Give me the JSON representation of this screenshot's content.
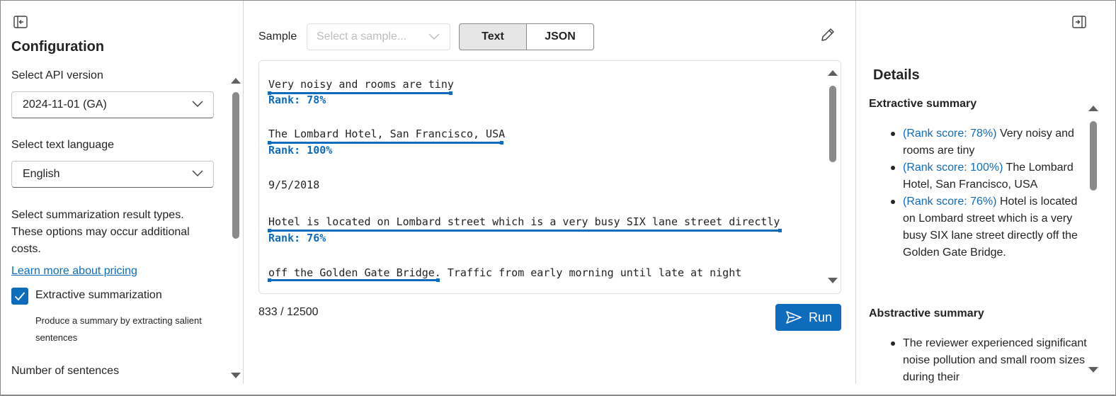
{
  "config": {
    "title": "Configuration",
    "api_version_label": "Select API version",
    "api_version_value": "2024-11-01 (GA)",
    "language_label": "Select text language",
    "language_value": "English",
    "result_types_desc": "Select summarization result types. These options may occur additional costs.",
    "pricing_link": "Learn more about pricing",
    "extractive_checked": true,
    "extractive_label": "Extractive summarization",
    "extractive_desc": "Produce a summary by extracting salient sentences",
    "num_sentences_label": "Number of sentences"
  },
  "editor": {
    "sample_label": "Sample",
    "sample_placeholder": "Select a sample...",
    "tab_text": "Text",
    "tab_json": "JSON",
    "lines": [
      {
        "text": "Very noisy and rooms are tiny",
        "rank": "Rank: 78%"
      },
      {
        "text": "The Lombard Hotel, San Francisco, USA",
        "rank": "Rank: 100%"
      },
      {
        "text": "9/5/2018",
        "rank": ""
      },
      {
        "text": "Hotel is located on Lombard street which is a very busy SIX lane street directly",
        "rank": "Rank: 76%"
      },
      {
        "text": "off the Golden Gate Bridge. Traffic from early morning until late at night",
        "rank": ""
      }
    ],
    "char_count": "833 / 12500",
    "run_label": "Run"
  },
  "details": {
    "title": "Details",
    "extractive_title": "Extractive summary",
    "extractive_items": [
      {
        "score": "(Rank score: 78%)",
        "text": " Very noisy and rooms are tiny"
      },
      {
        "score": "(Rank score: 100%)",
        "text": " The Lombard Hotel, San Francisco, USA"
      },
      {
        "score": "(Rank score: 76%)",
        "text": " Hotel is located on Lombard street which is a very busy SIX lane street directly off the Golden Gate Bridge."
      }
    ],
    "abstractive_title": "Abstractive summary",
    "abstractive_items": [
      {
        "text": "The reviewer experienced significant noise pollution and small room sizes during their"
      }
    ]
  },
  "colors": {
    "accent": "#0f6cbd"
  },
  "icons": {
    "collapse_left": "panel-collapse-icon",
    "expand_right": "panel-expand-icon",
    "edit": "pencil-icon",
    "run": "send-icon",
    "dropdown": "chevron-down-icon",
    "check": "checkmark-icon"
  }
}
